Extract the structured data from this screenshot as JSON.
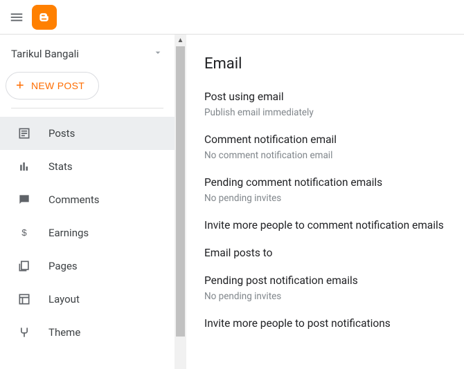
{
  "blog_name": "Tarikul Bangali",
  "new_post_label": "NEW POST",
  "nav": {
    "posts": "Posts",
    "stats": "Stats",
    "comments": "Comments",
    "earnings": "Earnings",
    "pages": "Pages",
    "layout": "Layout",
    "theme": "Theme"
  },
  "section_heading": "Email",
  "settings": {
    "post_using_email": {
      "title": "Post using email",
      "sub": "Publish email immediately"
    },
    "comment_notification_email": {
      "title": "Comment notification email",
      "sub": "No comment notification email"
    },
    "pending_comment_emails": {
      "title": "Pending comment notification emails",
      "sub": "No pending invites"
    },
    "invite_comment": {
      "title": "Invite more people to comment notification emails"
    },
    "email_posts_to": {
      "title": "Email posts to"
    },
    "pending_post_emails": {
      "title": "Pending post notification emails",
      "sub": "No pending invites"
    },
    "invite_post": {
      "title": "Invite more people to post notifications"
    }
  }
}
